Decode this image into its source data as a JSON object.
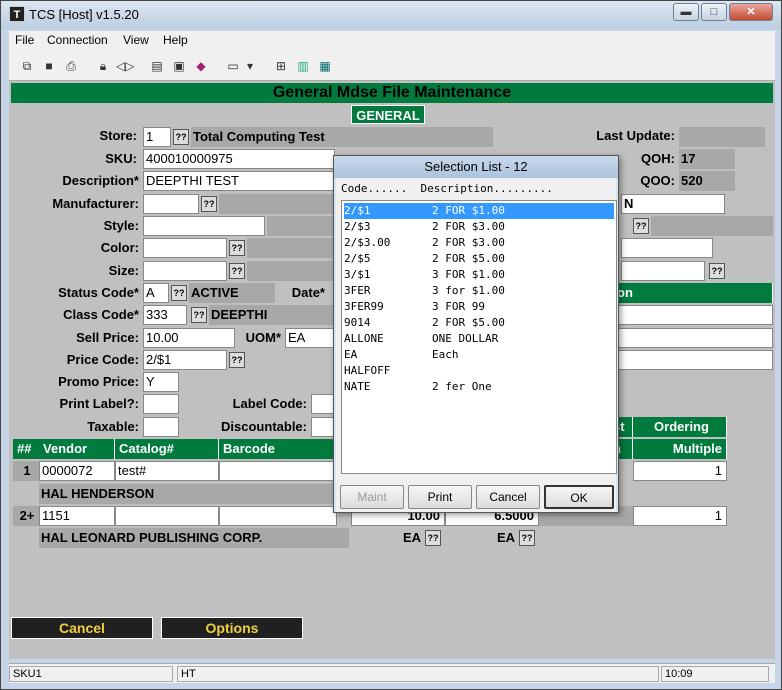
{
  "window": {
    "title": "TCS [Host]  v1.5.20",
    "app_icon": "T",
    "minimize": "▬",
    "maximize": "□",
    "close": "✕"
  },
  "menu": [
    "File",
    "Connection",
    "View",
    "Help"
  ],
  "toolbar_icons": [
    "copy-icon",
    "save-icon",
    "print-icon",
    "lock-icon",
    "connect-icon",
    "properties-icon",
    "monitor-icon",
    "book-icon",
    "page-icon",
    "dropdown-icon",
    "tree-icon",
    "chart-icon",
    "calculator-icon"
  ],
  "form": {
    "title": "General Mdse File Maintenance",
    "tab": "GENERAL",
    "q": "??",
    "labels": {
      "store": "Store:",
      "sku": "SKU:",
      "description": "Description*",
      "manufacturer": "Manufacturer:",
      "style": "Style:",
      "color": "Color:",
      "size": "Size:",
      "status_code": "Status Code*",
      "date": "Date*",
      "class_code": "Class Code*",
      "sell_price": "Sell Price:",
      "uom": "UOM*",
      "price_code": "Price Code:",
      "promo_price": "Promo Price:",
      "print_label": "Print Label?:",
      "label_code": "Label Code:",
      "taxable": "Taxable:",
      "discountable": "Discountable:",
      "last_update": "Last Update:",
      "qoh": "QOH:",
      "qoo": "QOO:"
    },
    "values": {
      "store": "1",
      "store_name": "Total Computing Test",
      "sku": "400010000975",
      "description": "DEEPTHI TEST",
      "status_code": "A",
      "status_text": "ACTIVE",
      "class_code": "333",
      "class_text": "DEEPTHI",
      "sell_price": "10.00",
      "uom": "EA",
      "price_code": "2/$1",
      "promo_price": "Y",
      "qoh": "17",
      "qoo": "520",
      "n_field": "N",
      "right_green": "on"
    },
    "grid": {
      "headers": [
        "##",
        "Vendor",
        "Catalog#",
        "Barcode"
      ],
      "right_headers": [
        "st",
        "Ordering"
      ],
      "right_headers2": [
        "h",
        "Multiple"
      ],
      "rows": [
        {
          "num": "1",
          "vendor": "0000072",
          "catalog": "test#",
          "multiple": "1",
          "vendor_name": "HAL HENDERSON"
        },
        {
          "num": "2+",
          "vendor": "1151",
          "catalog": "",
          "cost1": "10.00",
          "cost2": "6.5000",
          "multiple": "1",
          "vendor_name": "HAL LEONARD PUBLISHING CORP.",
          "uom1": "EA",
          "uom2": "EA"
        }
      ]
    },
    "buttons": {
      "cancel": "Cancel",
      "options": "Options"
    }
  },
  "dialog": {
    "title": "Selection List - 12",
    "column_header": "Code......  Description.........",
    "items": [
      {
        "code": "2/$1",
        "desc": "2 FOR $1.00"
      },
      {
        "code": "2/$3",
        "desc": "2 FOR $3.00"
      },
      {
        "code": "2/$3.00",
        "desc": "2 FOR $3.00"
      },
      {
        "code": "2/$5",
        "desc": "2 FOR $5.00"
      },
      {
        "code": "3/$1",
        "desc": "3 FOR $1.00"
      },
      {
        "code": "3FER",
        "desc": "3 for $1.00"
      },
      {
        "code": "3FER99",
        "desc": "3 FOR 99"
      },
      {
        "code": "9014",
        "desc": "2 FOR $5.00"
      },
      {
        "code": "ALLONE",
        "desc": "ONE DOLLAR"
      },
      {
        "code": "EA",
        "desc": "Each"
      },
      {
        "code": "HALFOFF",
        "desc": ""
      },
      {
        "code": "NATE",
        "desc": "2 fer One"
      }
    ],
    "buttons": {
      "maint": "Maint",
      "print": "Print",
      "cancel": "Cancel",
      "ok": "OK"
    }
  },
  "status": {
    "left": "SKU1",
    "mid": "HT",
    "time": "10:09"
  }
}
